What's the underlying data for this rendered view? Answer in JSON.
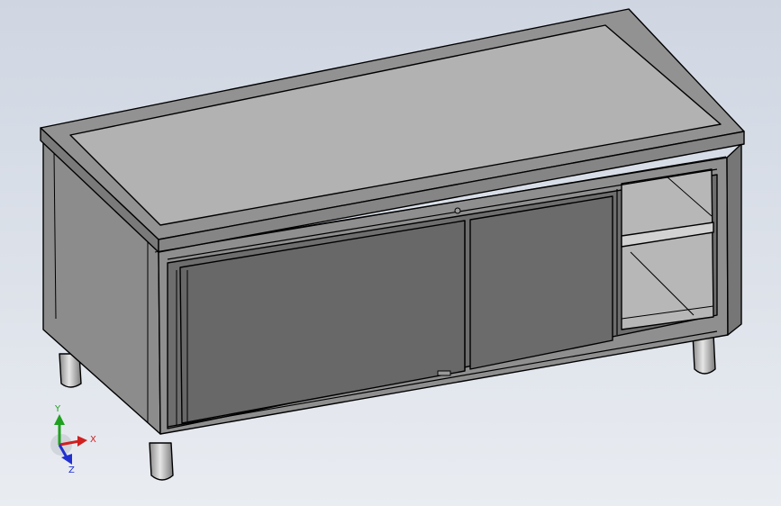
{
  "window": {
    "type": "3D CAD model viewport"
  },
  "triad": {
    "x_label": "X",
    "y_label": "Y",
    "z_label": "Z",
    "colors": {
      "x": "#d02020",
      "y": "#20a020",
      "z": "#2030d0"
    }
  }
}
